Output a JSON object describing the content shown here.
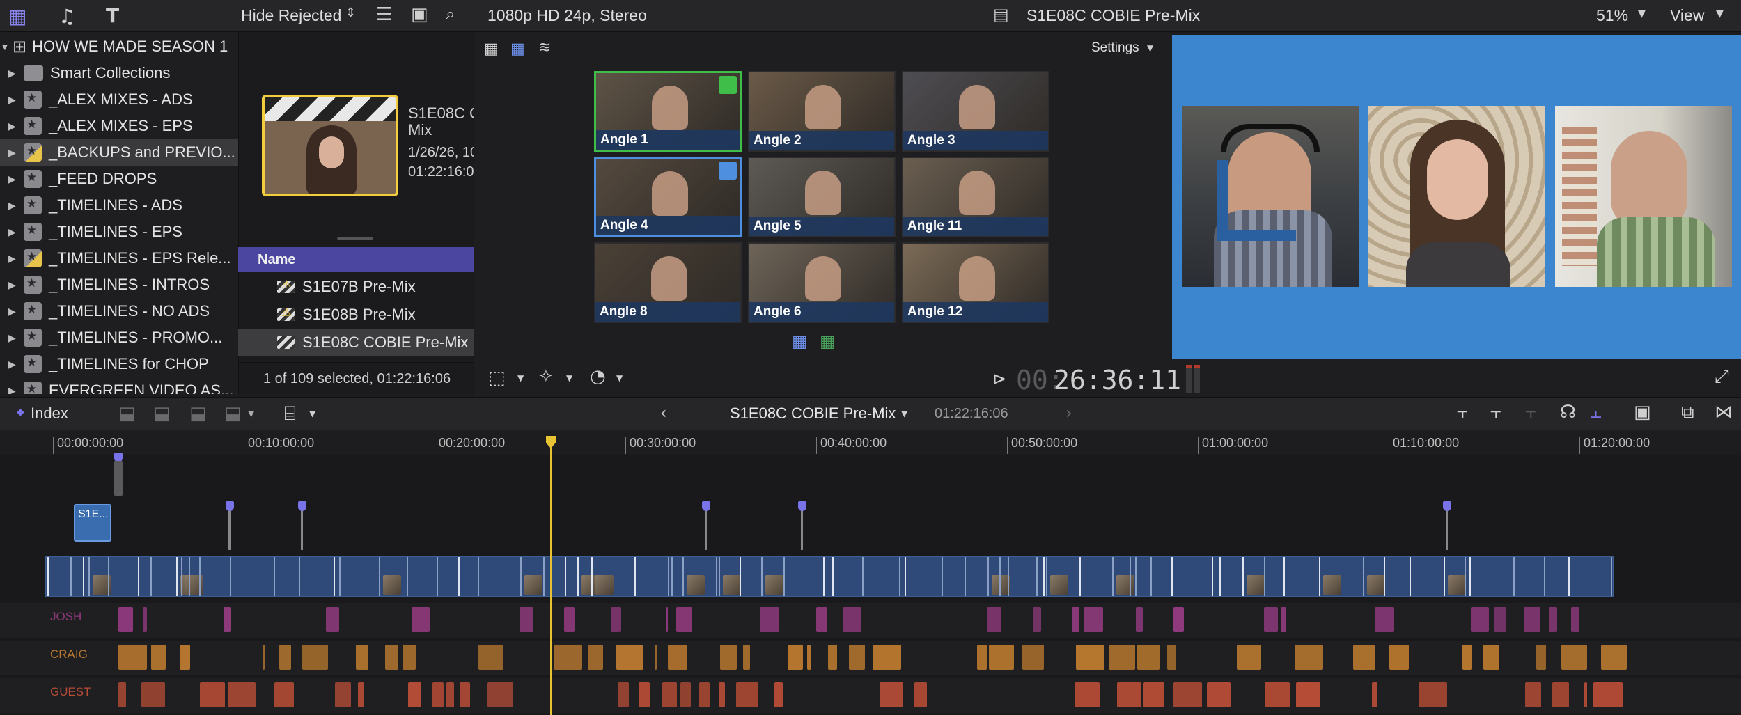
{
  "toolbar": {
    "filter": "Hide Rejected",
    "format": "1080p HD 24p, Stereo",
    "project_title": "S1E08C COBIE Pre-Mix",
    "zoom": "51%",
    "view": "View"
  },
  "library": {
    "title": "HOW WE MADE SEASON 1",
    "items": [
      {
        "label": "Smart Collections",
        "kind": "folder"
      },
      {
        "label": "_ALEX MIXES - ADS",
        "kind": "event"
      },
      {
        "label": "_ALEX MIXES - EPS",
        "kind": "event"
      },
      {
        "label": "_BACKUPS and PREVIO...",
        "kind": "event-warn",
        "selected": true
      },
      {
        "label": "_FEED DROPS",
        "kind": "event"
      },
      {
        "label": "_TIMELINES - ADS",
        "kind": "event"
      },
      {
        "label": "_TIMELINES - EPS",
        "kind": "event"
      },
      {
        "label": "_TIMELINES - EPS Rele...",
        "kind": "event-warn"
      },
      {
        "label": "_TIMELINES - INTROS",
        "kind": "event"
      },
      {
        "label": "_TIMELINES - NO ADS",
        "kind": "event"
      },
      {
        "label": "_TIMELINES - PROMO...",
        "kind": "event"
      },
      {
        "label": "_TIMELINES for CHOP",
        "kind": "event"
      },
      {
        "label": "EVERGREEN VIDEO AS...",
        "kind": "event"
      }
    ]
  },
  "browser": {
    "clip_title_line1": "S1E08C C",
    "clip_title_line2": "Mix",
    "clip_date": "1/26/26, 10",
    "clip_duration": "01:22:16:0",
    "name_header": "Name",
    "clips": [
      {
        "label": "S1E07B Pre-Mix",
        "warn": true
      },
      {
        "label": "S1E08B Pre-Mix",
        "warn": true
      },
      {
        "label": "S1E08C COBIE Pre-Mix",
        "warn": false,
        "selected": true
      }
    ],
    "status": "1 of 109 selected, 01:22:16:06"
  },
  "angle_viewer": {
    "settings": "Settings",
    "angles": [
      "Angle 1",
      "Angle 2",
      "Angle 3",
      "Angle 4",
      "Angle 5",
      "Angle 11",
      "Angle 8",
      "Angle 6",
      "Angle 12"
    ]
  },
  "viewer": {
    "timecode_dim": "00:",
    "timecode": "26:36:11"
  },
  "timeline": {
    "index": "Index",
    "project": "S1E08C COBIE Pre-Mix",
    "duration": "01:22:16:06",
    "ticks": [
      "00:00:00:00",
      "00:10:00:00",
      "00:20:00:00",
      "00:30:00:00",
      "00:40:00:00",
      "00:50:00:00",
      "01:00:00:00",
      "01:10:00:00",
      "01:20:00:00"
    ],
    "connected_clip": "S1E...",
    "lanes": [
      {
        "name": "JOSH",
        "color": "#8e3a7c"
      },
      {
        "name": "CRAIG",
        "color": "#b8782f"
      },
      {
        "name": "GUEST",
        "color": "#b44c36"
      }
    ],
    "primary_color": "#2f4a78"
  }
}
